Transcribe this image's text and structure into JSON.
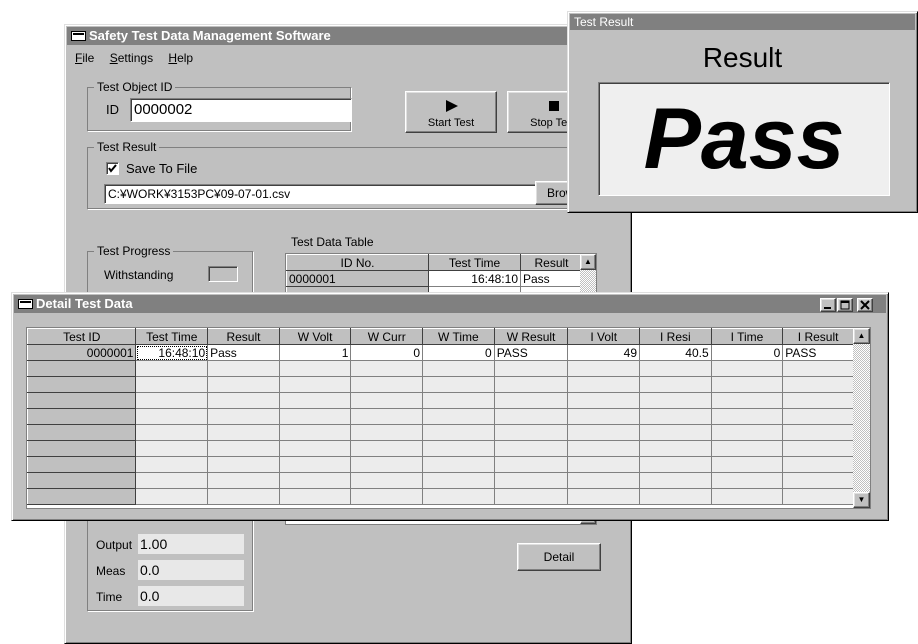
{
  "main_window": {
    "title": "Safety Test Data Management Software",
    "menu": [
      {
        "label": "File",
        "key": "F",
        "rest": "ile"
      },
      {
        "label": "Settings",
        "key": "S",
        "rest": "ettings"
      },
      {
        "label": "Help",
        "key": "H",
        "rest": "elp"
      }
    ],
    "test_object_group": "Test Object ID",
    "id_label": "ID",
    "id_value": "0000002",
    "start_label": "Start Test",
    "stop_label": "Stop Test",
    "test_result_group": "Test Result",
    "save_to_file_label": "Save To File",
    "save_to_file_checked": true,
    "file_path": "C:¥WORK¥3153PC¥09-07-01.csv",
    "browse_label": "Browse",
    "test_progress_group": "Test Progress",
    "withstanding_label": "Withstanding",
    "output_label": "Output",
    "output_value": "1.00",
    "meas_label": "Meas",
    "meas_value": "0.0",
    "time_label": "Time",
    "time_value": "0.0",
    "table_title": "Test Data Table",
    "table_columns": [
      "ID No.",
      "Test Time",
      "Result"
    ],
    "table_rows": [
      [
        "0000001",
        "16:48:10",
        "Pass"
      ]
    ],
    "detail_label": "Detail"
  },
  "result_window": {
    "title": "Test Result",
    "heading": "Result",
    "value": "Pass"
  },
  "detail_window": {
    "title": "Detail Test Data",
    "columns": [
      "Test ID",
      "Test Time",
      "Result",
      "W Volt",
      "W Curr",
      "W Time",
      "W Result",
      "I Volt",
      "I Resi",
      "I Time",
      "I Result"
    ],
    "rows": [
      [
        "0000001",
        "16:48:10",
        "Pass",
        "1",
        "0",
        "0",
        "PASS",
        "49",
        "40.5",
        "0",
        "PASS"
      ]
    ],
    "empty_rows": 9
  },
  "colors": {
    "face": "#c0c0c0",
    "title_inactive": "#808080",
    "result_box": "#efefef"
  },
  "icons": {
    "start": "play-triangle-icon",
    "stop": "stop-square-icon",
    "minimize": "minimize-icon",
    "maximize": "maximize-icon",
    "close": "close-icon",
    "scroll_up": "scroll-up-arrow-icon",
    "scroll_down": "scroll-down-arrow-icon"
  }
}
